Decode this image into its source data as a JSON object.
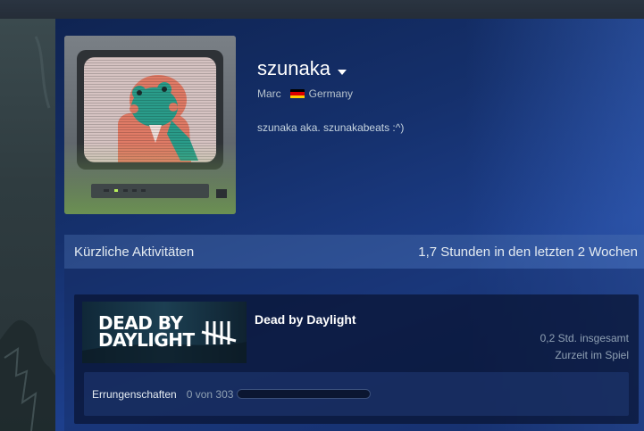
{
  "profile": {
    "persona_name": "szunaka",
    "real_name": "Marc",
    "country": "Germany",
    "summary": "szunaka aka. szunakabeats :^)",
    "flag_colors": [
      "#000000",
      "#dd0000",
      "#ffce00"
    ]
  },
  "activity": {
    "header_label": "Kürzliche Aktivitäten",
    "playtime_summary": "1,7 Stunden in den letzten 2 Wochen"
  },
  "game": {
    "name": "Dead by Daylight",
    "capsule_line1": "DEAD BY",
    "capsule_line2": "DAYLIGHT",
    "hours_total": "0,2 Std. insgesamt",
    "status": "Zurzeit im Spiel",
    "achievements_label": "Errungenschaften",
    "achievements_count": "0 von 303",
    "achievements_progress": 0
  },
  "colors": {
    "panel_accent": "#1d3f8c",
    "progress_fill": "#4f94bc"
  },
  "icons": {
    "dropdown": "caret-down-icon",
    "flag": "germany-flag-icon"
  }
}
